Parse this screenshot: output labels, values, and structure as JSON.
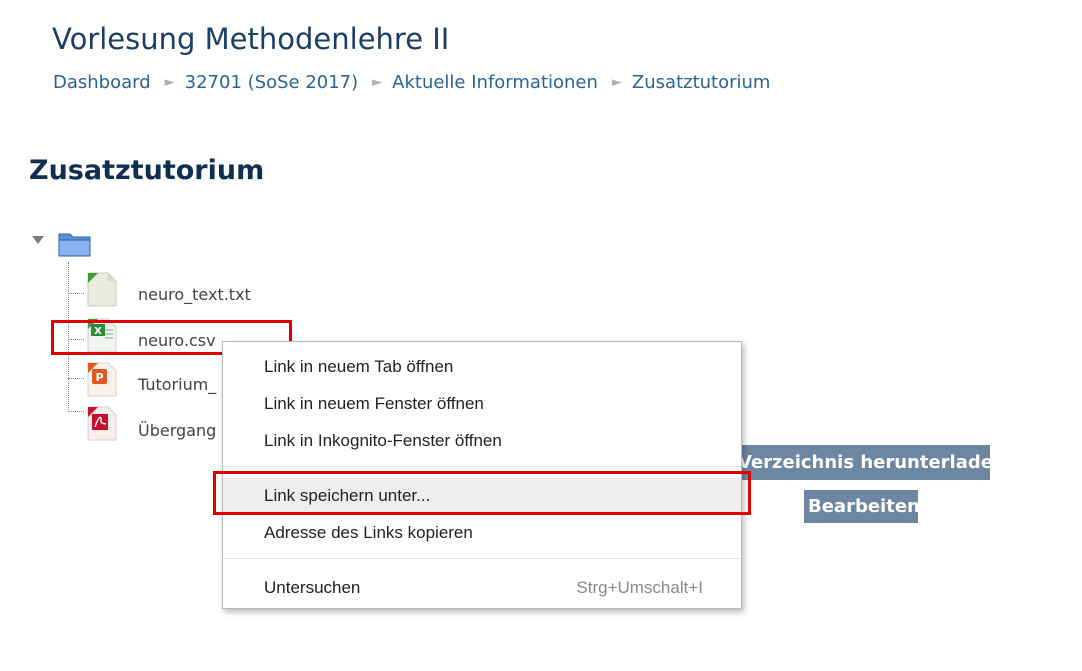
{
  "course": {
    "title": "Vorlesung Methodenlehre II"
  },
  "breadcrumb": {
    "items": [
      "Dashboard",
      "32701 (SoSe 2017)",
      "Aktuelle Informationen",
      "Zusatztutorium"
    ],
    "separator": "►"
  },
  "page": {
    "heading": "Zusatztutorium"
  },
  "files": [
    {
      "name": "neuro_text.txt",
      "icon": "text-file-icon"
    },
    {
      "name": "neuro.csv",
      "icon": "excel-file-icon"
    },
    {
      "name": "Tutorium_",
      "icon": "powerpoint-file-icon"
    },
    {
      "name": "Übergang",
      "icon": "pdf-file-icon"
    }
  ],
  "buttons": {
    "download": "Verzeichnis herunterladen",
    "edit": "Bearbeiten"
  },
  "context_menu": {
    "items": [
      {
        "label": "Link in neuem Tab öffnen"
      },
      {
        "label": "Link in neuem Fenster öffnen"
      },
      {
        "label": "Link in Inkognito-Fenster öffnen"
      },
      {
        "label": "Link speichern unter..."
      },
      {
        "label": "Adresse des Links kopieren"
      },
      {
        "label": "Untersuchen",
        "shortcut": "Strg+Umschalt+I"
      }
    ],
    "highlighted_index": 3
  },
  "colors": {
    "highlight": "#e00000",
    "link": "#2a6496",
    "button": "#6d87a3",
    "heading": "#0f2f52"
  }
}
